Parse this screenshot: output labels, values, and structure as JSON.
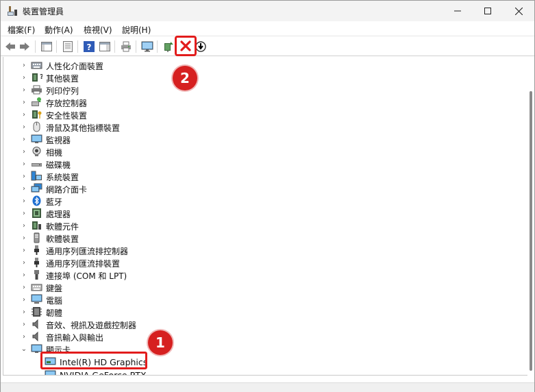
{
  "window": {
    "title": "裝置管理員"
  },
  "menu": [
    "檔案(F)",
    "動作(A)",
    "檢視(V)",
    "說明(H)"
  ],
  "toolbar": {
    "back": "back-arrow-icon",
    "forward": "forward-arrow-icon",
    "uninstall": "red-x-icon"
  },
  "tree": {
    "categories": [
      {
        "label": "人性化介面裝置",
        "icon": "hid-icon"
      },
      {
        "label": "其他裝置",
        "icon": "other-device-icon"
      },
      {
        "label": "列印佇列",
        "icon": "printer-icon"
      },
      {
        "label": "存放控制器",
        "icon": "storage-icon"
      },
      {
        "label": "安全性裝置",
        "icon": "security-icon"
      },
      {
        "label": "滑鼠及其他指標裝置",
        "icon": "mouse-icon"
      },
      {
        "label": "監視器",
        "icon": "monitor-icon"
      },
      {
        "label": "相機",
        "icon": "camera-icon"
      },
      {
        "label": "磁碟機",
        "icon": "disk-icon"
      },
      {
        "label": "系統裝置",
        "icon": "system-icon"
      },
      {
        "label": "網路介面卡",
        "icon": "network-icon"
      },
      {
        "label": "藍牙",
        "icon": "bluetooth-icon"
      },
      {
        "label": "處理器",
        "icon": "processor-icon"
      },
      {
        "label": "軟體元件",
        "icon": "software-component-icon"
      },
      {
        "label": "軟體裝置",
        "icon": "software-device-icon"
      },
      {
        "label": "通用序列匯流排控制器",
        "icon": "usb-controller-icon"
      },
      {
        "label": "通用序列匯流排裝置",
        "icon": "usb-device-icon"
      },
      {
        "label": "連接埠 (COM 和 LPT)",
        "icon": "port-icon"
      },
      {
        "label": "鍵盤",
        "icon": "keyboard-icon"
      },
      {
        "label": "電腦",
        "icon": "computer-icon"
      },
      {
        "label": "韌體",
        "icon": "firmware-icon"
      },
      {
        "label": "音效、視訊及遊戲控制器",
        "icon": "audio-icon"
      },
      {
        "label": "音訊輸入與輸出",
        "icon": "audio-io-icon"
      },
      {
        "label": "顯示卡",
        "icon": "display-adapter-icon",
        "expanded": true
      }
    ],
    "display_children": [
      {
        "label": "Intel(R) HD Graphics",
        "selected": true
      },
      {
        "label": "NVIDIA GeForce RTX"
      }
    ]
  },
  "callouts": [
    "1",
    "2"
  ],
  "colors": {
    "highlight": "#e21c1c",
    "badge": "#d62020"
  }
}
